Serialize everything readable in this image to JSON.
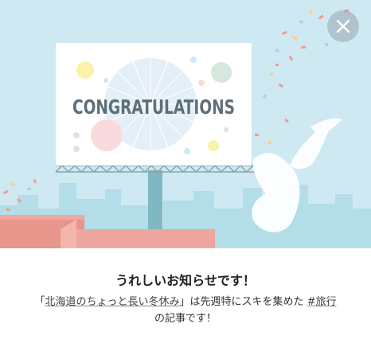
{
  "banner": {
    "billboard_text": "CONGRATULATIONS",
    "colors": {
      "sky": "#cfe9f3",
      "city": "#b3dde7",
      "billboard_face": "#ffffff",
      "billboard_text": "#5e6f7a",
      "roof": "#ec9a8f",
      "dove": "#ffffff"
    }
  },
  "close_button": {
    "icon": "close-icon"
  },
  "message": {
    "headline": "うれしいお知らせです！",
    "open_quote": "「",
    "article_title": "北海道のちょっと長い冬休み",
    "close_quote": "」は先週特にスキを集めた",
    "hashtag": "#旅行",
    "suffix": "の記事です！"
  }
}
